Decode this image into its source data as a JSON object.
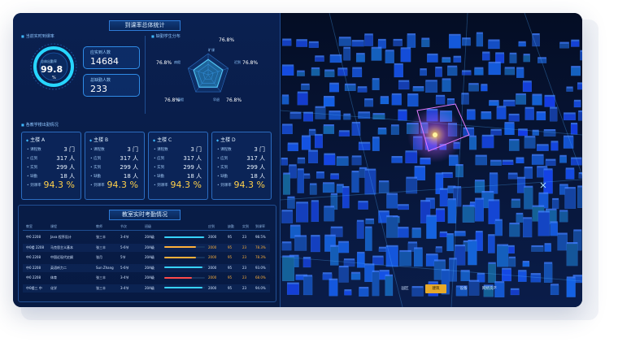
{
  "header": {
    "title": "到课率总体统计"
  },
  "attendance": {
    "section_label": "当前实时到课率",
    "gauge_label": "总体出勤率",
    "gauge_value": "99.8",
    "gauge_unit": "%",
    "gauge_level": 0.998,
    "expected_label": "应实到人数",
    "expected_value": "14684",
    "actual_label": "总缺勤人数",
    "actual_value": "233"
  },
  "radar": {
    "section_label": "缺勤学生分布",
    "labels": [
      "旷课",
      "迟到",
      "早退",
      "请假",
      "病假"
    ],
    "values": [
      "76.8",
      "76.8",
      "76.8",
      "76.8",
      "76.8"
    ],
    "unit": "%"
  },
  "buildings": {
    "section_label": "各教学楼出勤情况",
    "row_labels": [
      "课程数",
      "应到",
      "实到",
      "缺勤",
      "到课率"
    ],
    "items": [
      {
        "name": "主楼 A",
        "courses": "3",
        "courses_unit": "门",
        "expected": "317",
        "actual": "299",
        "absent": "18",
        "rate": "94.3",
        "unit_people": "人",
        "unit_pct": "%"
      },
      {
        "name": "主楼 B",
        "courses": "3",
        "courses_unit": "门",
        "expected": "317",
        "actual": "299",
        "absent": "18",
        "rate": "94.3",
        "unit_people": "人",
        "unit_pct": "%"
      },
      {
        "name": "主楼 C",
        "courses": "3",
        "courses_unit": "门",
        "expected": "317",
        "actual": "299",
        "absent": "18",
        "rate": "94.3",
        "unit_people": "人",
        "unit_pct": "%"
      },
      {
        "name": "主楼 D",
        "courses": "3",
        "courses_unit": "门",
        "expected": "317",
        "actual": "299",
        "absent": "18",
        "rate": "94.3",
        "unit_people": "人",
        "unit_pct": "%"
      }
    ]
  },
  "classroom": {
    "title": "教室实时考勤情况",
    "headers": [
      "教室",
      "课程",
      "教师",
      "节次",
      "班级",
      "",
      "应到",
      "缺勤",
      "实到",
      "到课率"
    ],
    "rows": [
      {
        "room": "中0 2208",
        "course": "Java 程序设计",
        "teacher": "张三丰",
        "period": "3-4节",
        "class": "20A级",
        "expected": "2000",
        "absent": "95",
        "actual": "23",
        "rate": "98.5%",
        "bar_color": "#38d3ff",
        "level": 0.98,
        "warn": false
      },
      {
        "room": "中0楼 2208",
        "course": "马克思主义基本",
        "teacher": "张三丰",
        "period": "5-6节",
        "class": "20A级",
        "expected": "2000",
        "absent": "95",
        "actual": "23",
        "rate": "78.3%",
        "bar_color": "#ffb03a",
        "level": 0.78,
        "warn": true
      },
      {
        "room": "中0 2208",
        "course": "中国近现代史纲",
        "teacher": "张月",
        "period": "5节",
        "class": "20A级",
        "expected": "2000",
        "absent": "95",
        "actual": "23",
        "rate": "78.3%",
        "bar_color": "#ffb03a",
        "level": 0.78,
        "warn": true
      },
      {
        "room": "中0 2208",
        "course": "英语听力二",
        "teacher": "Sun Zhang",
        "period": "5-6节",
        "class": "20A级",
        "expected": "2000",
        "absent": "95",
        "actual": "23",
        "rate": "93.0%",
        "bar_color": "#38d3ff",
        "level": 0.93,
        "warn": false
      },
      {
        "room": "中0 2208",
        "course": "体育",
        "teacher": "张三丰",
        "period": "3-4节",
        "class": "20A级",
        "expected": "2000",
        "absent": "95",
        "actual": "23",
        "rate": "68.0%",
        "bar_color": "#ff4a4a",
        "level": 0.68,
        "warn": true
      },
      {
        "room": "中0楼三 中",
        "course": "化学",
        "teacher": "张三丰",
        "period": "3-4节",
        "class": "20A级",
        "expected": "2000",
        "absent": "95",
        "actual": "23",
        "rate": "94.0%",
        "bar_color": "#38d3ff",
        "level": 0.94,
        "warn": false
      }
    ]
  },
  "map_controls": {
    "buttons": [
      {
        "label": "园区",
        "active": false
      },
      {
        "label": "建筑",
        "active": true
      },
      {
        "label": "设备",
        "active": false
      },
      {
        "label": "网络资产",
        "active": false
      }
    ]
  },
  "colors": {
    "accent": "#3fb8ff",
    "gold": "#ffd04a",
    "warn": "#ffb03a",
    "danger": "#ff4a4a",
    "panel_bg": "#0a2050"
  }
}
